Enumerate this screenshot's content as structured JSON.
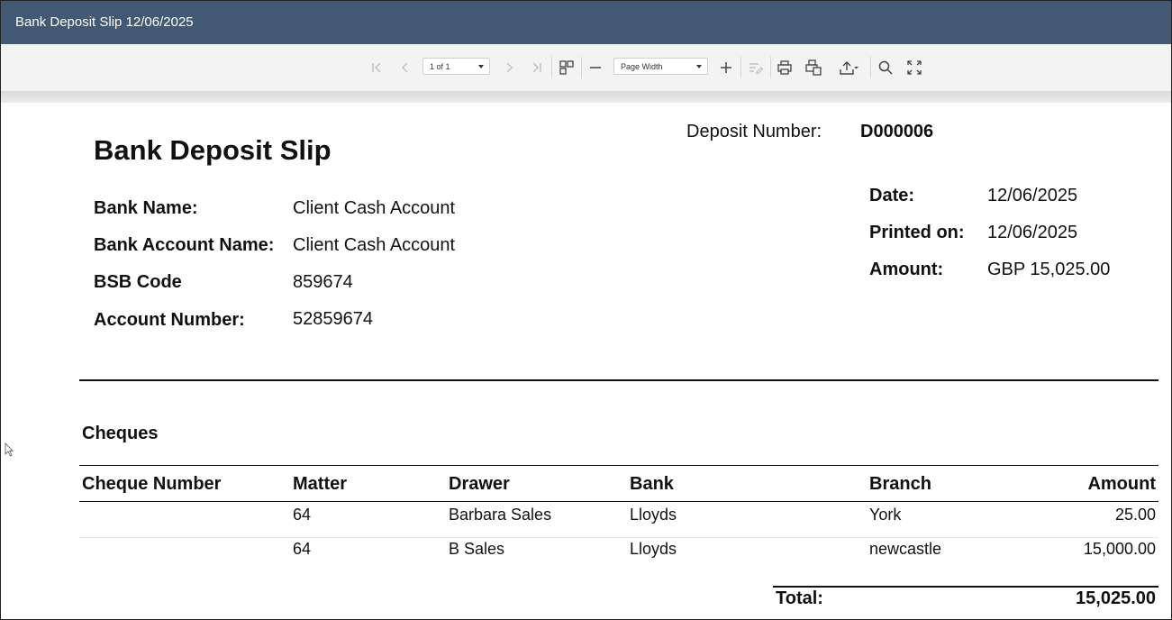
{
  "window": {
    "title": "Bank Deposit Slip 12/06/2025"
  },
  "toolbar": {
    "page_selector": "1 of 1",
    "zoom_selector": "Page Width"
  },
  "report": {
    "title": "Bank Deposit Slip",
    "deposit_number_label": "Deposit Number:",
    "deposit_number": "D000006",
    "bank_name_label": "Bank Name:",
    "bank_name": "Client Cash Account",
    "bank_account_name_label": "Bank Account Name:",
    "bank_account_name": "Client Cash Account",
    "bsb_code_label": "BSB Code",
    "bsb_code": "859674",
    "account_number_label": "Account Number:",
    "account_number": "52859674",
    "date_label": "Date:",
    "date": "12/06/2025",
    "printed_on_label": "Printed on:",
    "printed_on": "12/06/2025",
    "amount_label": "Amount:",
    "amount": "GBP 15,025.00",
    "section_title": "Cheques",
    "columns": [
      "Cheque Number",
      "Matter",
      "Drawer",
      "Bank",
      "Branch",
      "Amount"
    ],
    "rows": [
      [
        "",
        "64",
        "Barbara Sales",
        "Lloyds",
        "York",
        "25.00"
      ],
      [
        "",
        "64",
        "B Sales",
        "Lloyds",
        "newcastle",
        "15,000.00"
      ]
    ],
    "total_label": "Total:",
    "total": "15,025.00"
  }
}
